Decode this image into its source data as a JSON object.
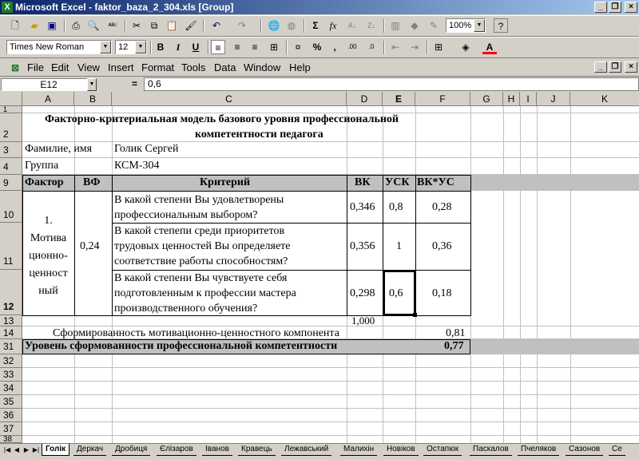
{
  "window": {
    "title": "Microsoft Excel - faktor_baza_2_304.xls  [Group]"
  },
  "toolbar": {
    "zoom": "100%",
    "font": "Times New Roman",
    "font_size": "12"
  },
  "menu": [
    "File",
    "Edit",
    "View",
    "Insert",
    "Format",
    "Tools",
    "Data",
    "Window",
    "Help"
  ],
  "formula": {
    "cell_ref": "E12",
    "equals": "=",
    "value": "0,6"
  },
  "columns": [
    "A",
    "B",
    "C",
    "D",
    "E",
    "F",
    "G",
    "H",
    "I",
    "J",
    "K"
  ],
  "rows": {
    "r1": "1",
    "r2": "2",
    "r3": "3",
    "r4": "4",
    "r9": "9",
    "r10": "10",
    "r11": "11",
    "r12": "12",
    "r13": "13",
    "r14": "14",
    "r31": "31",
    "r32": "32",
    "r33": "33",
    "r34": "34",
    "r35": "35",
    "r36": "36",
    "r37": "37",
    "r38": "38"
  },
  "sheet": {
    "title_line1": "Факторно-критериальная модель базового уровня профессиональной",
    "title_line2": "компетентности педагога",
    "name_label": "Фамилие, имя",
    "name_value": "Голик Сергей",
    "group_label": "Группа",
    "group_value": "КСМ-304",
    "header": {
      "factor": "Фактор",
      "vf": "ВФ",
      "criterion": "Критерий",
      "vk": "ВК",
      "usk": "УСК",
      "vkus": "ВК*УС"
    },
    "factor_lines": [
      "1.",
      "Мотива",
      "ционно-",
      "ценност",
      "ный"
    ],
    "vf_value": "0,24",
    "criteria": [
      {
        "lines": [
          "В какой степени Вы удовлетворены",
          "профессиональным выбором?"
        ],
        "vk": "0,346",
        "usk": "0,8",
        "vkus": "0,28"
      },
      {
        "lines": [
          "В какой степепи среди приоритетов",
          "трудовых ценностей Вы определяете",
          "соответствие работы способностям?"
        ],
        "vk": "0,356",
        "usk": "1",
        "vkus": "0,36"
      },
      {
        "lines": [
          "В какой степени Вы чувствуете себя",
          "подготовленным к профессии мастера",
          "производственного обучения?"
        ],
        "vk": "0,298",
        "usk": "0,6",
        "vkus": "0,18"
      }
    ],
    "sum_vk": "1,000",
    "formed_label": "Сформированность мотивационно-ценностного компонента",
    "formed_value": "0,81",
    "level_label": "Уровень сформованности профессиональной компетентности",
    "level_value": "0,77"
  },
  "tabs": [
    "Голік",
    "Деркач",
    "Дробиця",
    "Єлізаров",
    "Іванов",
    "Кравець",
    "Лежавський",
    "Малихін",
    "Новіков",
    "Остапюк",
    "Паскалов",
    "Пчеляков",
    "Сазонов",
    "Се"
  ]
}
